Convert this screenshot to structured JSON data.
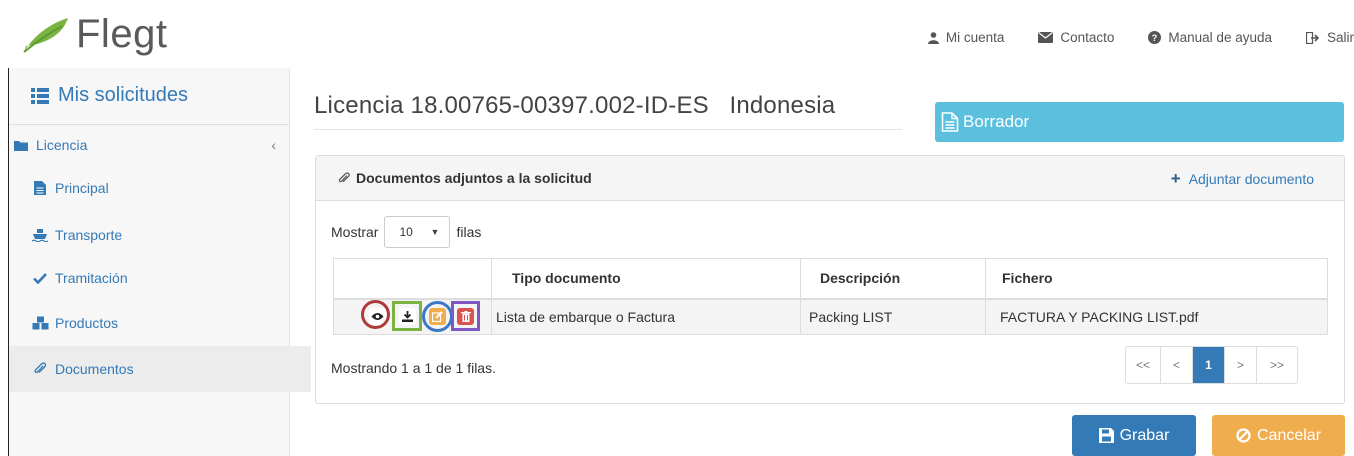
{
  "brand": {
    "name": "Flegt"
  },
  "topnav": [
    {
      "label": "Mi cuenta",
      "icon": "user-icon"
    },
    {
      "label": "Contacto",
      "icon": "envelope-icon"
    },
    {
      "label": "Manual de ayuda",
      "icon": "question-circle-icon"
    },
    {
      "label": "Salir",
      "icon": "sign-out-icon"
    }
  ],
  "sidebar": {
    "title": "Mis solicitudes",
    "section": "Licencia",
    "items": [
      {
        "label": "Principal",
        "icon": "file-icon"
      },
      {
        "label": "Transporte",
        "icon": "ship-icon"
      },
      {
        "label": "Tramitación",
        "icon": "check-icon"
      },
      {
        "label": "Productos",
        "icon": "cubes-icon"
      },
      {
        "label": "Documentos",
        "icon": "paperclip-icon",
        "active": true
      }
    ]
  },
  "main": {
    "title": "Licencia 18.00765-00397.002-ID-ES   Indonesia",
    "status": "Borrador"
  },
  "panel": {
    "title": "Documentos adjuntos a la solicitud",
    "add_link": "Adjuntar documento",
    "show_prefix": "Mostrar",
    "page_size": "10",
    "show_suffix": "filas",
    "columns": [
      "Tipo documento",
      "Descripción",
      "Fichero"
    ],
    "rows": [
      {
        "tipo": "Lista de embarque o Factura",
        "descripcion": "Packing LIST",
        "fichero": "FACTURA Y PACKING LIST.pdf"
      }
    ],
    "footer": "Mostrando 1 a 1 de 1 filas.",
    "pagination": [
      "<<",
      "<",
      "1",
      ">",
      ">>"
    ]
  },
  "buttons": {
    "save": "Grabar",
    "cancel": "Cancelar"
  },
  "colors": {
    "primary": "#337ab7",
    "info": "#5bc0de",
    "warning": "#f0ad4e",
    "danger": "#d9534f",
    "success": "#5cb85c"
  }
}
